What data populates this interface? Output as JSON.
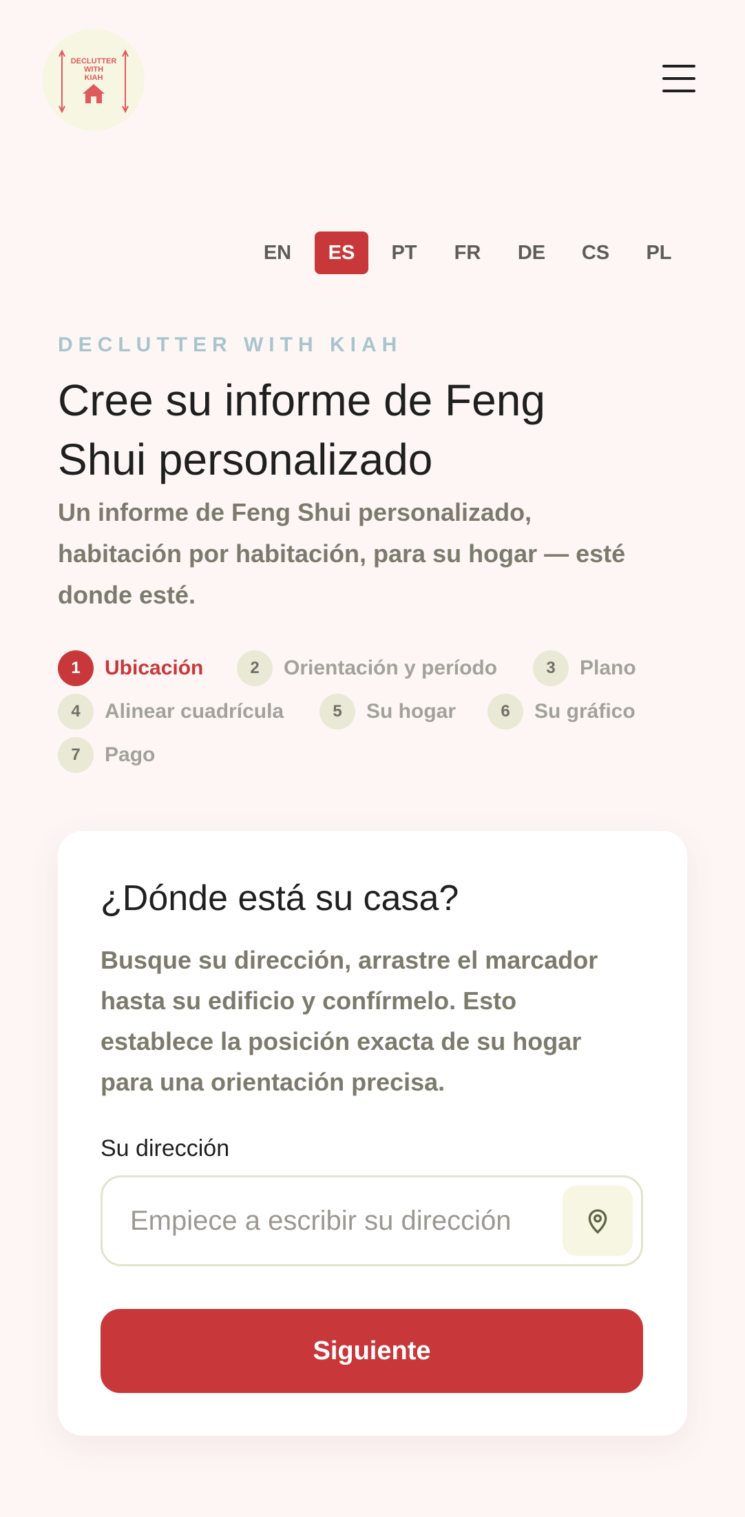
{
  "header": {
    "logo_text": [
      "DECLUTTER",
      "WITH",
      "KIAH"
    ],
    "menu_icon": "hamburger-menu-icon"
  },
  "languages": {
    "items": [
      "EN",
      "ES",
      "PT",
      "FR",
      "DE",
      "CS",
      "PL"
    ],
    "active": "ES"
  },
  "hero": {
    "eyebrow": "DECLUTTER WITH KIAH",
    "title_line1": "Cree su informe de Feng",
    "title_line2": "Shui personalizado",
    "subtitle_line1": "Un informe de Feng Shui personalizado,",
    "subtitle_line2": "habitación por habitación, para su hogar — esté",
    "subtitle_line3": "donde esté."
  },
  "steps": [
    {
      "num": "1",
      "label": "Ubicación",
      "current": true
    },
    {
      "num": "2",
      "label": "Orientación y período"
    },
    {
      "num": "3",
      "label": "Plano"
    },
    {
      "num": "4",
      "label": "Alinear cuadrícula"
    },
    {
      "num": "5",
      "label": "Su hogar"
    },
    {
      "num": "6",
      "label": "Su gráfico"
    },
    {
      "num": "7",
      "label": "Pago"
    }
  ],
  "card": {
    "title": "¿Dónde está su casa?",
    "desc_line1": "Busque su dirección, arrastre el marcador",
    "desc_line2": "hasta su edificio y confírmelo. Esto",
    "desc_line3": "establece la posición exacta de su hogar",
    "desc_line4": "para una orientación precisa.",
    "field_label": "Su dirección",
    "address_value": "",
    "address_placeholder": "Empiece a escribir su dirección",
    "locate_icon": "location-pin-icon",
    "next_label": "Siguiente"
  },
  "colors": {
    "accent": "#c8383b",
    "background": "#fdf6f5",
    "muted_text": "#7c7a6d",
    "eyebrow": "#a9c5cc",
    "cream": "#f7f6e3"
  }
}
